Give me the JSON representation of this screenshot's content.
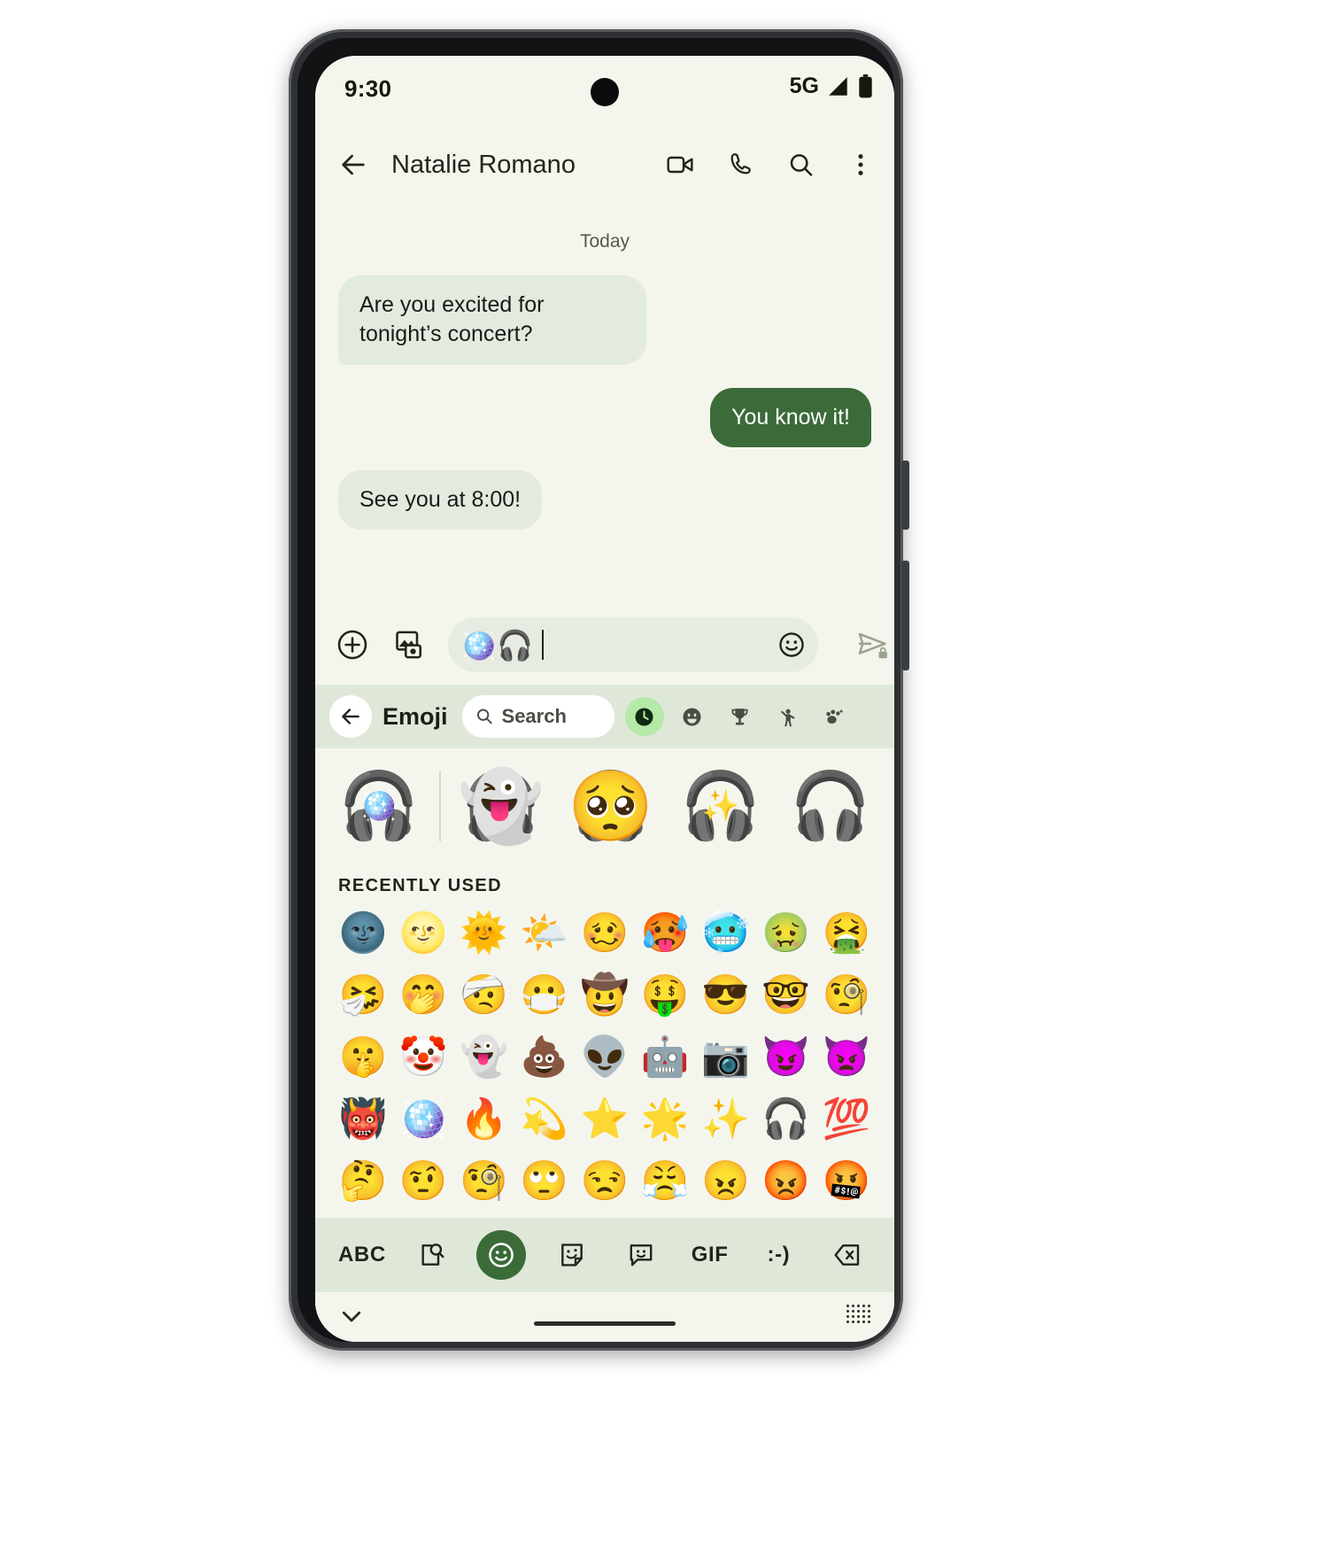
{
  "status_bar": {
    "time": "9:30",
    "network": "5G",
    "icons": [
      "signal-icon",
      "battery-icon"
    ]
  },
  "app_bar": {
    "back_icon": "back-arrow-icon",
    "contact_name": "Natalie Romano",
    "actions": [
      {
        "name": "video-call-icon",
        "label": "Video call"
      },
      {
        "name": "phone-call-icon",
        "label": "Call"
      },
      {
        "name": "search-icon",
        "label": "Search"
      },
      {
        "name": "overflow-menu-icon",
        "label": "More options"
      }
    ]
  },
  "conversation": {
    "day_divider": "Today",
    "messages": [
      {
        "direction": "incoming",
        "text": "Are you excited for tonight’s concert?"
      },
      {
        "direction": "outgoing",
        "text": "You know it!"
      },
      {
        "direction": "incoming",
        "text": "See you at 8:00!"
      }
    ]
  },
  "compose_bar": {
    "plus_icon": "plus-circle-icon",
    "gallery_icon": "gallery-icon",
    "input_value": "🪩🎧",
    "emoji_button_icon": "emoji-face-icon",
    "send_icon": "send-encrypted-icon"
  },
  "emoji_panel": {
    "back_icon": "back-arrow-icon",
    "title": "Emoji",
    "search_placeholder": "Search",
    "search_icon": "search-icon",
    "tabs": [
      {
        "name": "tab-recent",
        "icon": "clock-icon",
        "active": true
      },
      {
        "name": "tab-smileys",
        "icon": "smiley-icon",
        "active": false
      },
      {
        "name": "tab-activities",
        "icon": "trophy-icon",
        "active": false
      },
      {
        "name": "tab-people",
        "icon": "person-icon",
        "active": false
      },
      {
        "name": "tab-nature",
        "icon": "paw-icon",
        "active": false
      }
    ],
    "stickers": [
      {
        "name": "sticker-discoball-headphones",
        "base": "🎧",
        "over": "🪩",
        "kind": "mash-small"
      },
      {
        "name": "sticker-ghost-headphones",
        "base": "🎧",
        "over": "👻",
        "kind": "mash"
      },
      {
        "name": "sticker-pleading-headphones",
        "base": "🎧",
        "over": "🥺",
        "kind": "mash"
      },
      {
        "name": "sticker-sparkles-headphones",
        "base": "🎧",
        "over": "✨",
        "kind": "mash-small"
      },
      {
        "name": "sticker-partial",
        "base": "🎧",
        "over": "🎈",
        "kind": "mash-small"
      }
    ],
    "recently_used_label": "RECENTLY USED",
    "recently_used": [
      "🌚",
      "🌝",
      "🌞",
      "🌤️",
      "🥴",
      "🥵",
      "🥶",
      "🤢",
      "🤮",
      "🤧",
      "🤭",
      "🤕",
      "😷",
      "🤠",
      "🤑",
      "😎",
      "🤓",
      "🧐",
      "🤫",
      "🤡",
      "👻",
      "💩",
      "👽",
      "🤖",
      "📷",
      "😈",
      "👿",
      "👹",
      "🪩",
      "🔥",
      "💫",
      "⭐",
      "🌟",
      "✨",
      "🎧",
      "💯",
      "🤔",
      "🤨",
      "🧐",
      "🙄",
      "😒",
      "😤",
      "😠",
      "😡",
      "🤬"
    ]
  },
  "keyboard_toolbar": {
    "buttons": [
      {
        "name": "kb-abc-button",
        "label": "ABC",
        "icon": null,
        "active": false
      },
      {
        "name": "kb-search-button",
        "label": "",
        "icon": "page-search-icon",
        "active": false
      },
      {
        "name": "kb-emoji-button",
        "label": "",
        "icon": "emoji-face-icon",
        "active": true
      },
      {
        "name": "kb-sticker-button",
        "label": "",
        "icon": "sticker-icon",
        "active": false
      },
      {
        "name": "kb-emoji-kitchen-button",
        "label": "",
        "icon": "emoji-bubble-icon",
        "active": false
      },
      {
        "name": "kb-gif-button",
        "label": "GIF",
        "icon": null,
        "active": false
      },
      {
        "name": "kb-emoticon-button",
        "label": ":-)",
        "icon": null,
        "active": false
      },
      {
        "name": "kb-backspace-button",
        "label": "",
        "icon": "backspace-icon",
        "active": false
      }
    ]
  },
  "nav_bar": {
    "chevron_icon": "chevron-down-icon",
    "keyboard_icon": "keyboard-dots-icon"
  },
  "colors": {
    "screen_bg": "#f4f6ee",
    "incoming_bubble": "#e3ebe1",
    "outgoing_bubble": "#3a6b38",
    "panel_header": "#dfe8d8",
    "accent_green": "#b6e8a8",
    "text_primary": "#22241b"
  }
}
